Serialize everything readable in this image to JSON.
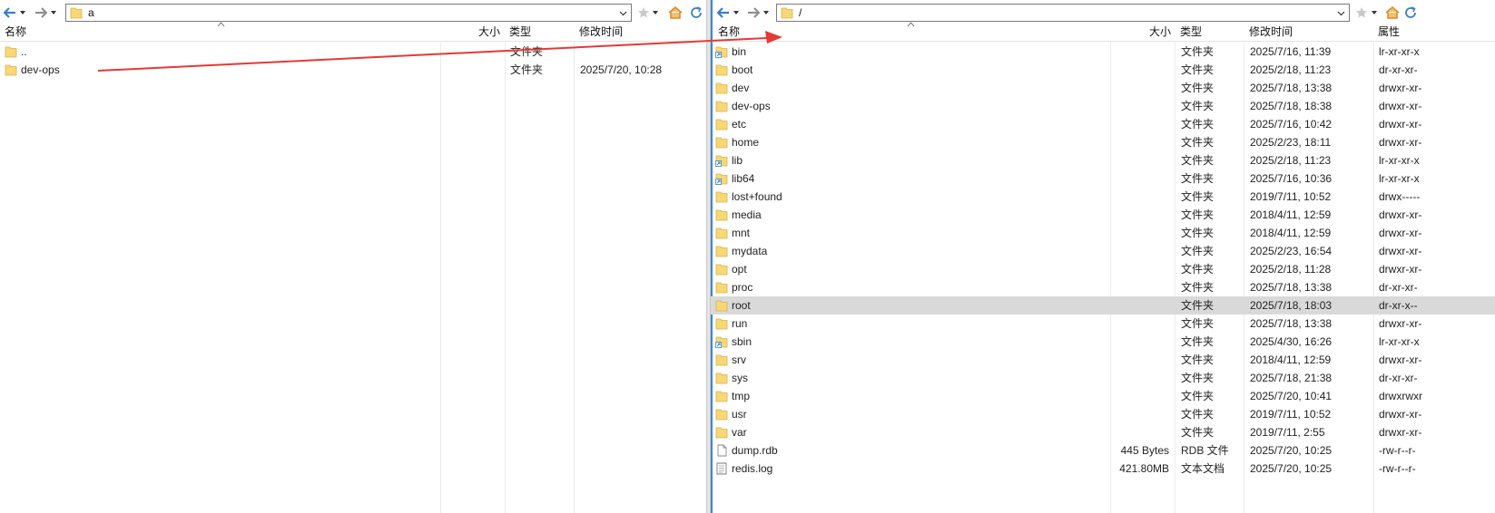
{
  "left": {
    "path": "a",
    "columns": {
      "name": "名称",
      "size": "大小",
      "type": "类型",
      "modified": "修改时间"
    },
    "rows": [
      {
        "name": "..",
        "size": "",
        "type": "文件夹",
        "modified": "",
        "icon": "folder-icon"
      },
      {
        "name": "dev-ops",
        "size": "",
        "type": "文件夹",
        "modified": "2025/7/20, 10:28",
        "icon": "folder-icon"
      }
    ]
  },
  "right": {
    "path": "/",
    "columns": {
      "name": "名称",
      "size": "大小",
      "type": "类型",
      "modified": "修改时间",
      "attributes": "属性"
    },
    "rows": [
      {
        "name": "bin",
        "size": "",
        "type": "文件夹",
        "modified": "2025/7/16, 11:39",
        "attributes": "lr-xr-xr-x",
        "icon": "folder-link-icon"
      },
      {
        "name": "boot",
        "size": "",
        "type": "文件夹",
        "modified": "2025/2/18, 11:23",
        "attributes": "dr-xr-xr-",
        "icon": "folder-icon"
      },
      {
        "name": "dev",
        "size": "",
        "type": "文件夹",
        "modified": "2025/7/18, 13:38",
        "attributes": "drwxr-xr-",
        "icon": "folder-icon"
      },
      {
        "name": "dev-ops",
        "size": "",
        "type": "文件夹",
        "modified": "2025/7/18, 18:38",
        "attributes": "drwxr-xr-",
        "icon": "folder-icon"
      },
      {
        "name": "etc",
        "size": "",
        "type": "文件夹",
        "modified": "2025/7/16, 10:42",
        "attributes": "drwxr-xr-",
        "icon": "folder-icon"
      },
      {
        "name": "home",
        "size": "",
        "type": "文件夹",
        "modified": "2025/2/23, 18:11",
        "attributes": "drwxr-xr-",
        "icon": "folder-icon"
      },
      {
        "name": "lib",
        "size": "",
        "type": "文件夹",
        "modified": "2025/2/18, 11:23",
        "attributes": "lr-xr-xr-x",
        "icon": "folder-link-icon"
      },
      {
        "name": "lib64",
        "size": "",
        "type": "文件夹",
        "modified": "2025/7/16, 10:36",
        "attributes": "lr-xr-xr-x",
        "icon": "folder-link-icon"
      },
      {
        "name": "lost+found",
        "size": "",
        "type": "文件夹",
        "modified": "2019/7/11, 10:52",
        "attributes": "drwx-----",
        "icon": "folder-icon"
      },
      {
        "name": "media",
        "size": "",
        "type": "文件夹",
        "modified": "2018/4/11, 12:59",
        "attributes": "drwxr-xr-",
        "icon": "folder-icon"
      },
      {
        "name": "mnt",
        "size": "",
        "type": "文件夹",
        "modified": "2018/4/11, 12:59",
        "attributes": "drwxr-xr-",
        "icon": "folder-icon"
      },
      {
        "name": "mydata",
        "size": "",
        "type": "文件夹",
        "modified": "2025/2/23, 16:54",
        "attributes": "drwxr-xr-",
        "icon": "folder-icon"
      },
      {
        "name": "opt",
        "size": "",
        "type": "文件夹",
        "modified": "2025/2/18, 11:28",
        "attributes": "drwxr-xr-",
        "icon": "folder-icon"
      },
      {
        "name": "proc",
        "size": "",
        "type": "文件夹",
        "modified": "2025/7/18, 13:38",
        "attributes": "dr-xr-xr-",
        "icon": "folder-icon"
      },
      {
        "name": "root",
        "size": "",
        "type": "文件夹",
        "modified": "2025/7/18, 18:03",
        "attributes": "dr-xr-x--",
        "icon": "folder-icon",
        "selected": true
      },
      {
        "name": "run",
        "size": "",
        "type": "文件夹",
        "modified": "2025/7/18, 13:38",
        "attributes": "drwxr-xr-",
        "icon": "folder-icon"
      },
      {
        "name": "sbin",
        "size": "",
        "type": "文件夹",
        "modified": "2025/4/30, 16:26",
        "attributes": "lr-xr-xr-x",
        "icon": "folder-link-icon"
      },
      {
        "name": "srv",
        "size": "",
        "type": "文件夹",
        "modified": "2018/4/11, 12:59",
        "attributes": "drwxr-xr-",
        "icon": "folder-icon"
      },
      {
        "name": "sys",
        "size": "",
        "type": "文件夹",
        "modified": "2025/7/18, 21:38",
        "attributes": "dr-xr-xr-",
        "icon": "folder-icon"
      },
      {
        "name": "tmp",
        "size": "",
        "type": "文件夹",
        "modified": "2025/7/20, 10:41",
        "attributes": "drwxrwxr",
        "icon": "folder-icon"
      },
      {
        "name": "usr",
        "size": "",
        "type": "文件夹",
        "modified": "2019/7/11, 10:52",
        "attributes": "drwxr-xr-",
        "icon": "folder-icon"
      },
      {
        "name": "var",
        "size": "",
        "type": "文件夹",
        "modified": "2019/7/11, 2:55",
        "attributes": "drwxr-xr-",
        "icon": "folder-icon"
      },
      {
        "name": "dump.rdb",
        "size": "445 Bytes",
        "type": "RDB 文件",
        "modified": "2025/7/20, 10:25",
        "attributes": "-rw-r--r-",
        "icon": "file-icon"
      },
      {
        "name": "redis.log",
        "size": "421.80MB",
        "type": "文本文档",
        "modified": "2025/7/20, 10:25",
        "attributes": "-rw-r--r-",
        "icon": "text-file-icon"
      }
    ]
  },
  "colors": {
    "arrow": "#e53935",
    "selected_row": "#d9d9d9",
    "folder": "#f8d775",
    "nav_arrow": "#3b7fc4"
  }
}
